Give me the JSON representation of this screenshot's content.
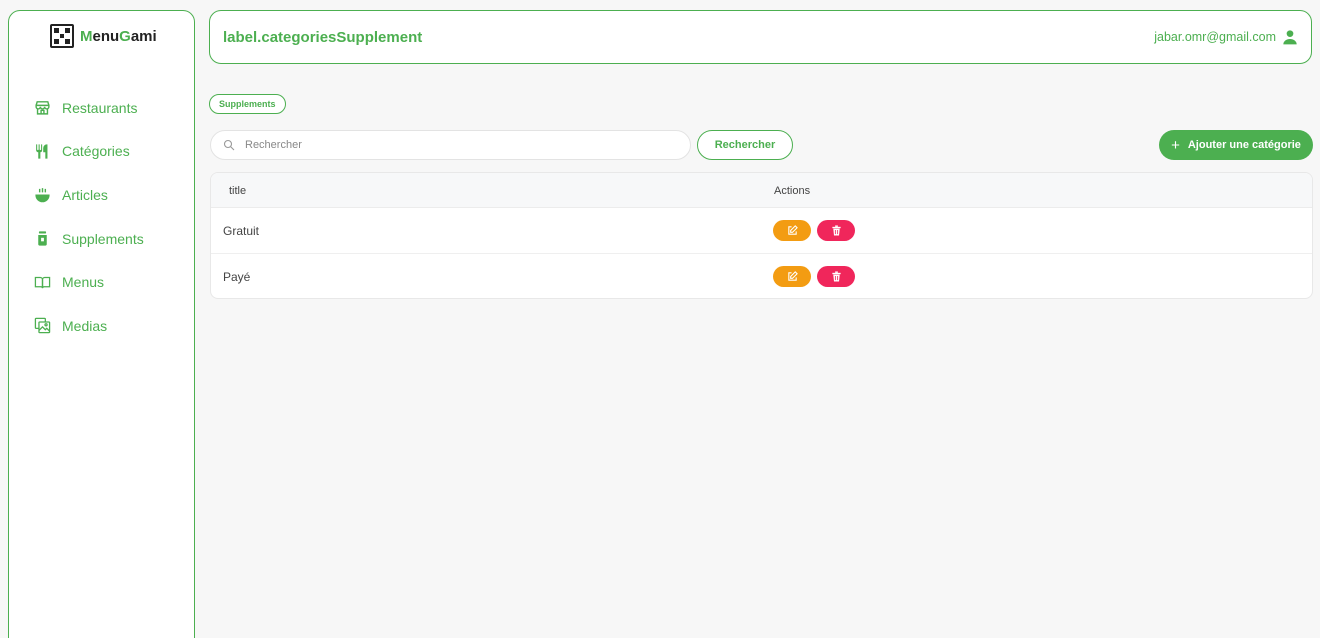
{
  "brand": {
    "part1": "Menu",
    "part2": "Gami",
    "m_initial": "M",
    "g_initial": "G"
  },
  "nav": [
    {
      "label": "Restaurants",
      "icon": "store-icon"
    },
    {
      "label": "Catégories",
      "icon": "utensils-icon"
    },
    {
      "label": "Articles",
      "icon": "bowl-icon"
    },
    {
      "label": "Supplements",
      "icon": "jar-icon"
    },
    {
      "label": "Menus",
      "icon": "book-icon"
    },
    {
      "label": "Medias",
      "icon": "images-icon"
    }
  ],
  "header": {
    "title": "label.categoriesSupplement",
    "user_email": "jabar.omr@gmail.com"
  },
  "breadcrumb": "Supplements",
  "search": {
    "placeholder": "Rechercher",
    "button_label": "Rechercher"
  },
  "add_button_label": "Ajouter une catégorie",
  "table": {
    "columns": [
      "title",
      "Actions"
    ],
    "rows": [
      {
        "title": "Gratuit"
      },
      {
        "title": "Payé"
      }
    ]
  },
  "colors": {
    "accent": "#4caf50",
    "edit": "#f39c12",
    "delete": "#f0265b"
  }
}
